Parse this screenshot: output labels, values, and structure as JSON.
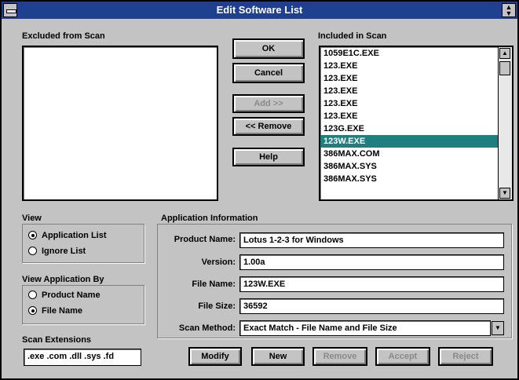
{
  "window": {
    "title": "Edit Software List"
  },
  "excluded": {
    "label": "Excluded from Scan",
    "items": []
  },
  "included": {
    "label": "Included in Scan",
    "items": [
      "1059E1C.EXE",
      "123.EXE",
      "123.EXE",
      "123.EXE",
      "123.EXE",
      "123.EXE",
      "123G.EXE",
      "123W.EXE",
      "386MAX.COM",
      "386MAX.SYS",
      "386MAX.SYS"
    ],
    "selected_index": 7
  },
  "buttons": {
    "ok": "OK",
    "cancel": "Cancel",
    "add": "Add >>",
    "remove": "<< Remove",
    "help": "Help",
    "modify": "Modify",
    "new": "New",
    "remove2": "Remove",
    "accept": "Accept",
    "reject": "Reject"
  },
  "view": {
    "label": "View",
    "options": [
      "Application List",
      "Ignore List"
    ],
    "selected": 0
  },
  "view_by": {
    "label": "View Application By",
    "options": [
      "Product Name",
      "File Name"
    ],
    "selected": 1
  },
  "scan_extensions": {
    "label": "Scan Extensions",
    "value": ".exe .com .dll .sys .fd"
  },
  "app_info": {
    "label": "Application Information",
    "product_name_label": "Product Name:",
    "product_name": "Lotus 1-2-3 for Windows",
    "version_label": "Version:",
    "version": "1.00a",
    "file_name_label": "File Name:",
    "file_name": "123W.EXE",
    "file_size_label": "File Size:",
    "file_size": "36592",
    "scan_method_label": "Scan Method:",
    "scan_method": "Exact Match - File Name and File Size"
  }
}
